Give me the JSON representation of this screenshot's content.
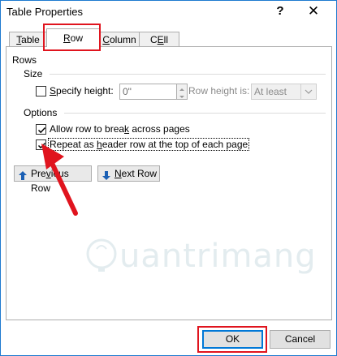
{
  "window": {
    "title": "Table Properties",
    "help_glyph": "?",
    "close_glyph": "✕"
  },
  "tabs": [
    {
      "label": "Table",
      "mnemonic": "T",
      "rest": "able",
      "active": false
    },
    {
      "label": "Row",
      "mnemonic": "R",
      "rest": "ow",
      "active": true
    },
    {
      "label": "Column",
      "mnemonic": "C",
      "rest": "olumn",
      "active": false
    },
    {
      "label": "Cell",
      "mnemonic": "E",
      "pre": "C",
      "rest": "ll",
      "active": false
    }
  ],
  "rows_section": {
    "heading": "Rows",
    "size_label": "Size",
    "specify_height": {
      "label": "Specify height:",
      "mnemonic": "S",
      "rest": "pecify height:",
      "checked": false
    },
    "height_value": "0\"",
    "row_height_is_label": "Row height is:",
    "row_height_is_value": "At least",
    "options_label": "Options",
    "allow_break": {
      "label": "Allow row to break across pages",
      "pre": "Allow row to brea",
      "mnemonic": "k",
      "rest": " across pages",
      "checked": true
    },
    "repeat_header": {
      "label": "Repeat as header row at the top of each page",
      "pre": "Repeat as ",
      "mnemonic": "h",
      "rest": "eader row at the top of each page",
      "checked": true
    }
  },
  "nav": {
    "previous_row": {
      "label": "Previous Row",
      "pre": "Pre",
      "mnemonic": "v",
      "rest": "ious Row"
    },
    "next_row": {
      "label": "Next Row",
      "mnemonic": "N",
      "rest": "ext Row"
    }
  },
  "footer": {
    "ok_label": "OK",
    "cancel_label": "Cancel"
  },
  "watermark": {
    "text": "uantrimang"
  },
  "colors": {
    "highlight": "#e0141e",
    "accent": "#1e7ad0",
    "arrow_icon": "#1a5fb4"
  }
}
